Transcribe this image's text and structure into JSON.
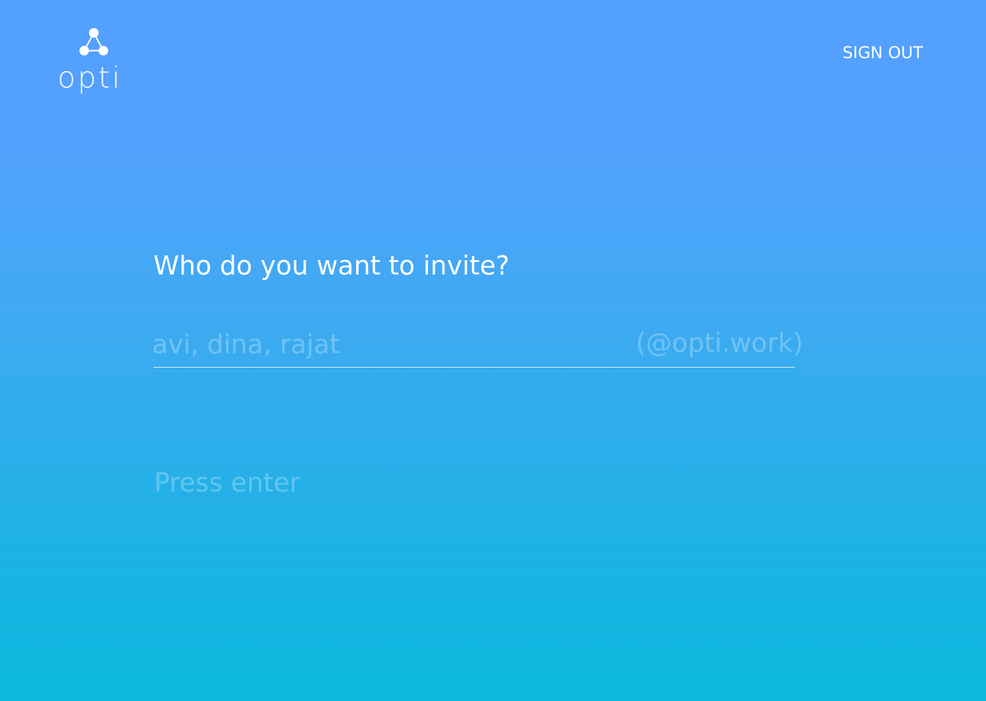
{
  "brand": {
    "name": "opti",
    "logo_icon": "network-triangle-icon"
  },
  "header": {
    "sign_out_label": "SIGN OUT"
  },
  "invite": {
    "question": "Who do you want to invite?",
    "input_value": "",
    "input_placeholder": "avi, dina, rajat",
    "domain_suffix": "(@opti.work)",
    "hint": "Press enter"
  },
  "colors": {
    "gradient_top": "#54a0ff",
    "gradient_bottom": "#0bb9dd",
    "text": "#ffffff"
  }
}
